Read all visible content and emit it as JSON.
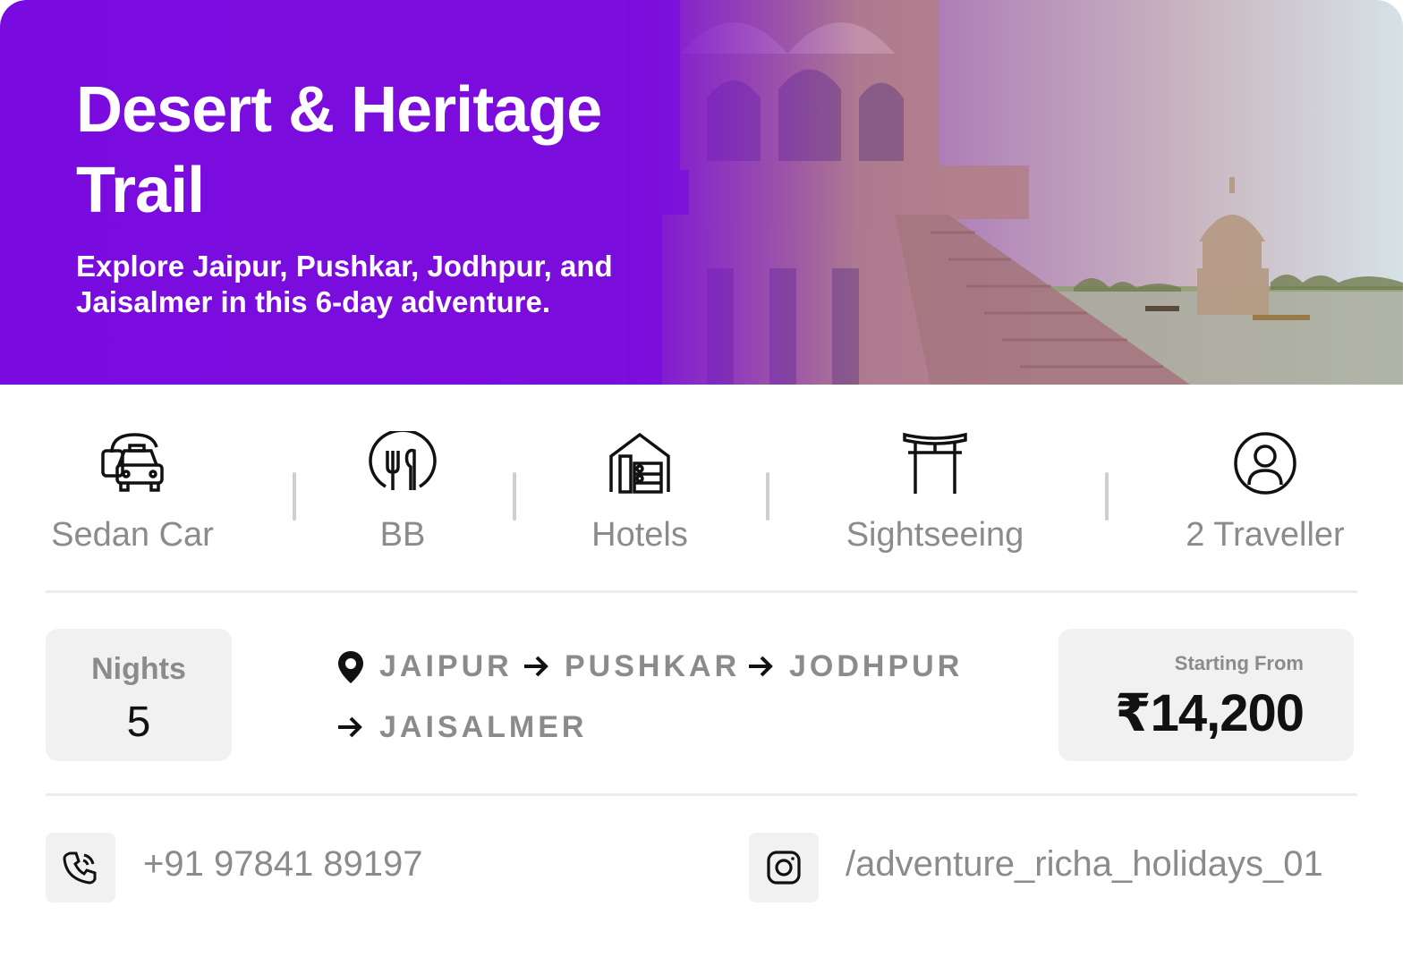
{
  "hero": {
    "title": "Desert & Heritage Trail",
    "subtitle": "Explore Jaipur, Pushkar, Jodhpur, and Jaisalmer in this 6-day adventure."
  },
  "features": [
    {
      "label": "Sedan Car",
      "icon": "taxi-car-icon"
    },
    {
      "label": "BB",
      "icon": "dining-plate-icon"
    },
    {
      "label": "Hotels",
      "icon": "hotel-house-icon"
    },
    {
      "label": "Sightseeing",
      "icon": "torii-gate-icon"
    },
    {
      "label": "2 Traveller",
      "icon": "user-circle-icon"
    }
  ],
  "nights": {
    "label": "Nights",
    "value": "5"
  },
  "route": {
    "icon": "location-pin-icon",
    "cities": [
      "JAIPUR",
      "PUSHKAR",
      "JODHPUR",
      "JAISALMER"
    ]
  },
  "price": {
    "label": "Starting From",
    "value": "₹14,200"
  },
  "contact": {
    "phone": "+91 97841 89197",
    "phone_icon": "phone-call-icon",
    "instagram": "/adventure_richa_holidays_01",
    "instagram_icon": "instagram-icon"
  },
  "colors": {
    "hero_purple": "#7a0be0",
    "muted_text": "#8b8b8b",
    "box_bg": "#f1f1f1"
  }
}
